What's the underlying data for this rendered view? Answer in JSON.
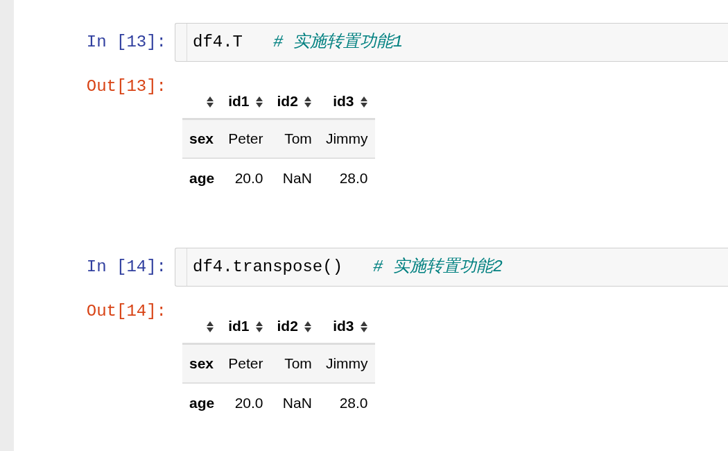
{
  "cells": [
    {
      "in_prompt": "In [13]:",
      "code": "df4.T",
      "comment": "# 实施转置功能1",
      "out_prompt": "Out[13]:",
      "table": {
        "columns": [
          "id1",
          "id2",
          "id3"
        ],
        "rows": [
          {
            "index": "sex",
            "values": [
              "Peter",
              "Tom",
              "Jimmy"
            ]
          },
          {
            "index": "age",
            "values": [
              "20.0",
              "NaN",
              "28.0"
            ]
          }
        ]
      }
    },
    {
      "in_prompt": "In [14]:",
      "code": "df4.transpose()",
      "comment": "# 实施转置功能2",
      "out_prompt": "Out[14]:",
      "table": {
        "columns": [
          "id1",
          "id2",
          "id3"
        ],
        "rows": [
          {
            "index": "sex",
            "values": [
              "Peter",
              "Tom",
              "Jimmy"
            ]
          },
          {
            "index": "age",
            "values": [
              "20.0",
              "NaN",
              "28.0"
            ]
          }
        ]
      }
    }
  ]
}
